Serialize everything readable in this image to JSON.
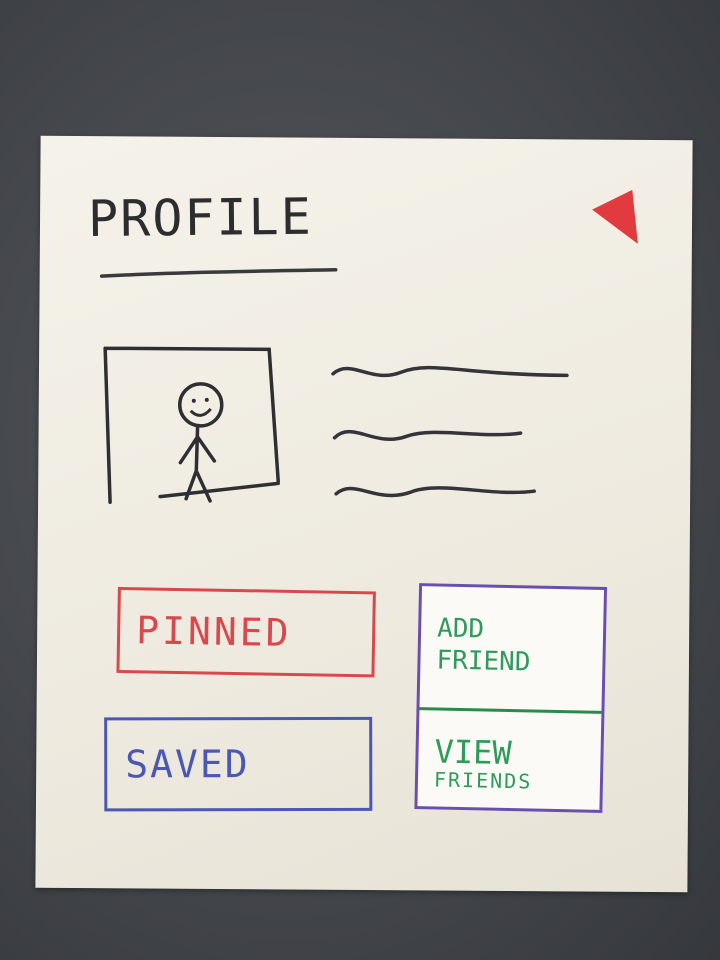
{
  "header": {
    "title": "PROFILE",
    "back_icon": "red-triangle-back-icon"
  },
  "profile": {
    "avatar_icon": "stick-figure-avatar-icon",
    "bio_lines": 3
  },
  "buttons": {
    "pinned": "PINNED",
    "saved": "SAVED",
    "add_friend": [
      "ADD",
      "FRIEND"
    ],
    "view_friends": [
      "VIEW",
      "FRIENDS"
    ]
  },
  "colors": {
    "ink": "#2d2d30",
    "pinned": "#d9484c",
    "saved": "#4a57b3",
    "friends_border": "#6a4fb0",
    "friends_text": "#2e9b5a",
    "back_icon": "#e23b3f"
  }
}
